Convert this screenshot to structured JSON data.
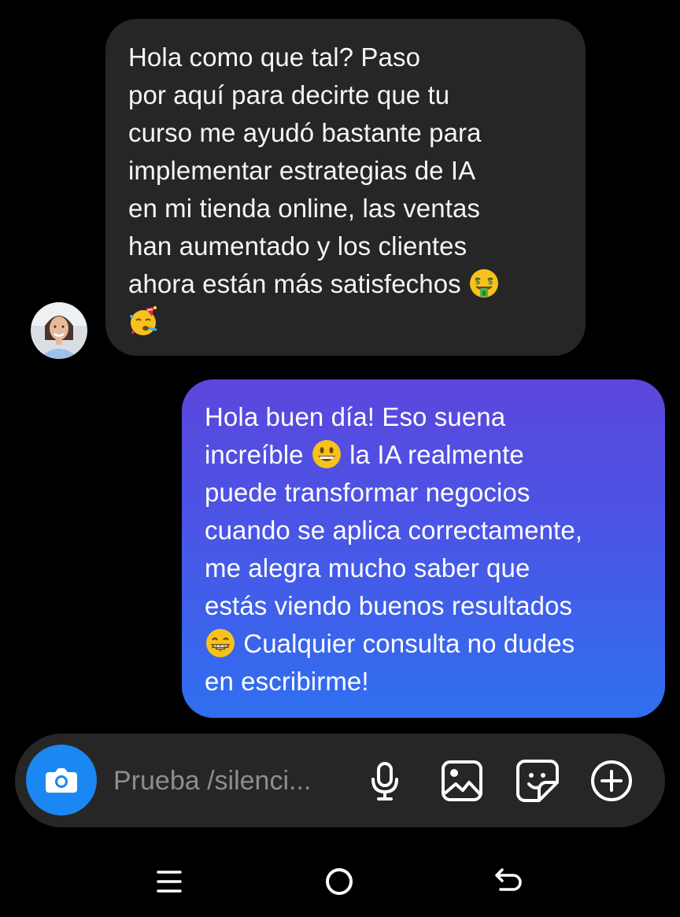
{
  "messages": {
    "received": {
      "text": "Hola como que tal? Paso\npor aquí para decirte que tu\ncurso me ayudó bastante para\nimplementar estrategias de IA\nen mi tienda online, las ventas\nhan aumentado y los clientes\nahora están más satisfechos ",
      "emojis": [
        "money-mouth-face",
        "partying-face"
      ]
    },
    "sent": {
      "line1": "Hola buen día! Eso suena\nincreíble ",
      "line2": " la IA realmente\npuede transformar negocios\ncuando se aplica correctamente,\nme alegra mucho saber que\nestás viendo buenos resultados\n",
      "line3": " Cualquier consulta no dudes\nen escribirme!",
      "emojis": [
        "grinning-face",
        "beaming-face"
      ]
    }
  },
  "composer": {
    "placeholder": "Prueba /silenci...",
    "icons": [
      "camera-icon",
      "microphone-icon",
      "gallery-icon",
      "sticker-icon",
      "add-circle-icon"
    ]
  },
  "navigation": {
    "icons": [
      "recent-apps-icon",
      "home-icon",
      "back-icon"
    ]
  },
  "colors": {
    "background": "#000000",
    "received_bubble": "#262626",
    "sent_gradient_top": "#5b47dc",
    "sent_gradient_bottom": "#2f6ff0",
    "camera_button": "#1b87f2",
    "placeholder": "#8e8e8e"
  }
}
